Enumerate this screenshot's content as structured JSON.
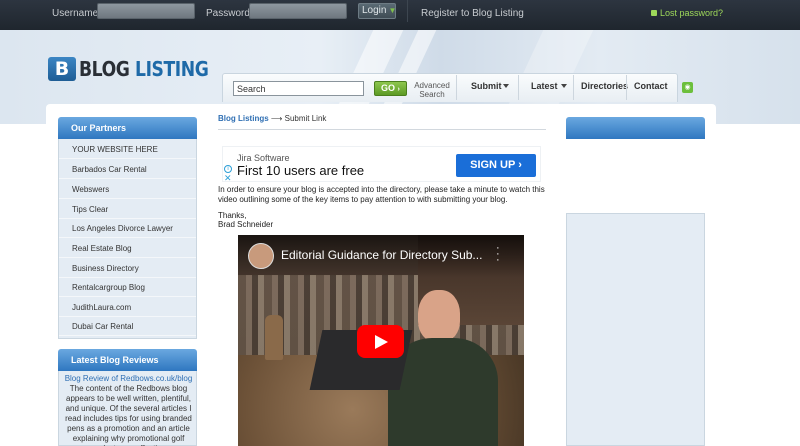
{
  "topbar": {
    "username_label": "Username:",
    "password_label": "Password:",
    "login_label": "Login",
    "register_label": "Register to Blog Listing",
    "lost_password_label": "Lost password?"
  },
  "logo": {
    "icon_letter": "B",
    "word": "BLOG",
    "accent": "LISTING"
  },
  "nav": {
    "search_value": "Search",
    "go_label": "GO",
    "advanced_line1": "Advanced",
    "advanced_line2": "Search",
    "items": [
      {
        "label": "Submit",
        "has_dropdown": true
      },
      {
        "label": "Latest",
        "has_dropdown": true
      },
      {
        "label": "Directories",
        "has_dropdown": false
      },
      {
        "label": "Contact",
        "has_dropdown": false
      }
    ]
  },
  "sidebar": {
    "partners_title": "Our Partners",
    "partners": [
      "YOUR WEBSITE HERE",
      "Barbados Car Rental",
      "Webswers",
      "Tips Clear",
      "Los Angeles Divorce Lawyer",
      "Real Estate Blog",
      "Business Directory",
      "Rentalcargroup Blog",
      "JudithLaura.com",
      "Dubai Car Rental"
    ],
    "reviews_title": "Latest Blog Reviews",
    "review_link": "Blog Review of Redbows.co.uk/blog",
    "review_text": "The content of the Redbows blog appears to be well written, plentiful, and unique. Of the several articles I read includes tips for using branded pens as a promotion and an article explaining why promotional golf products are effective."
  },
  "main": {
    "breadcrumb_link": "Blog Listings",
    "breadcrumb_arrow": "⟶",
    "breadcrumb_current": "Submit Link",
    "ad": {
      "brand": "Jira Software",
      "headline": "First 10 users are free",
      "button": "SIGN UP ›"
    },
    "intro": "In order to ensure your blog is accepted into the directory, please take a minute to watch this video outlining some of the key items to pay attention to with submitting your blog.",
    "thanks": "Thanks,",
    "signature": "Brad Schneider",
    "video_title": "Editorial Guidance for Directory Sub..."
  },
  "colors": {
    "topbar": "#242b33",
    "accent_blue": "#2f77c0",
    "link_blue": "#2f6fb3",
    "green": "#7fbf4d",
    "signup_blue": "#1a6ed8",
    "youtube_red": "#ff0000"
  },
  "icons": [
    "lock-icon",
    "rss-icon",
    "adchoices-icon",
    "close-icon",
    "play-icon",
    "more-options-icon",
    "chevron-down-icon"
  ]
}
